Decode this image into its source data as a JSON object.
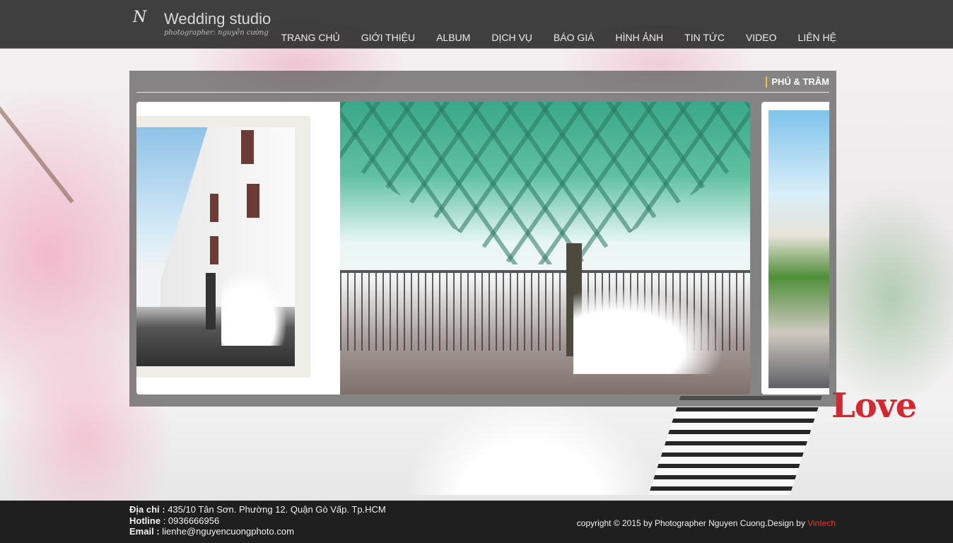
{
  "header": {
    "logo": {
      "mark": "N",
      "title": "Wedding studio",
      "subtitle": "photographer: nguyễn cường"
    },
    "nav": [
      {
        "label": "TRANG CHỦ"
      },
      {
        "label": "GIỚI THIỆU"
      },
      {
        "label": "ALBUM"
      },
      {
        "label": "DỊCH VỤ"
      },
      {
        "label": "BÁO GIÁ"
      },
      {
        "label": "HÌNH ẢNH"
      },
      {
        "label": "TIN TỨC"
      },
      {
        "label": "VIDEO"
      },
      {
        "label": "LIÊN HỆ"
      }
    ]
  },
  "background": {
    "love_text": "Love"
  },
  "album": {
    "title": "PHÚ & TRÂM"
  },
  "footer": {
    "address_label": "Địa chỉ :",
    "address_value": "435/10 Tân Sơn. Phường 12. Quận Gò Vấp. Tp.HCM",
    "hotline_label": "Hotline",
    "hotline_value": ": 0936666956",
    "email_label": "Email :",
    "email_value": "lienhe@nguyencuongphoto.com",
    "copyright_text": "copyright © 2015 by Photographer Nguyen Cuong.Design by ",
    "designer": "Vintech"
  },
  "colors": {
    "header_bg": "#262626",
    "footer_bg": "#1f1f1f",
    "accent_title_bar": "#f2c230",
    "designer_link": "#e33b2d",
    "love_sign": "#d8262f"
  }
}
